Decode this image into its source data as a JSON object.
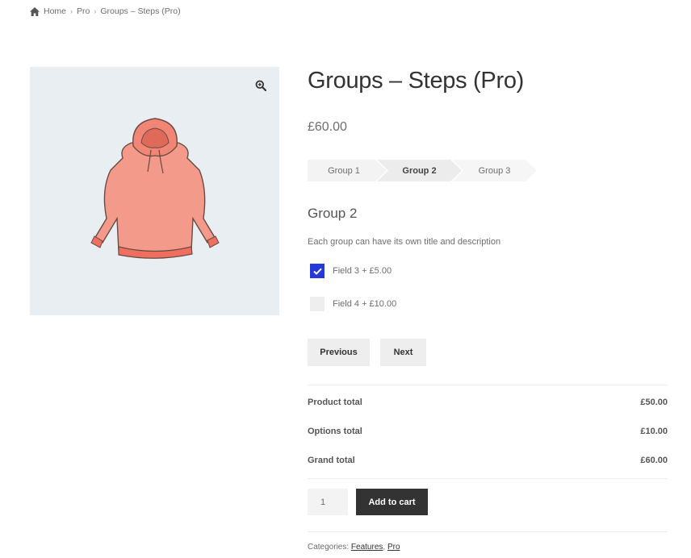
{
  "breadcrumb": {
    "home": "Home",
    "sep1": "›",
    "category": "Pro",
    "sep2": "›",
    "current": "Groups – Steps (Pro)"
  },
  "product": {
    "title": "Groups – Steps (Pro)",
    "price": "£60.00"
  },
  "steps": [
    {
      "label": "Group 1"
    },
    {
      "label": "Group 2"
    },
    {
      "label": "Group 3"
    }
  ],
  "group": {
    "title": "Group 2",
    "description": "Each group can have its own title and description"
  },
  "options": [
    {
      "label": "Field 3 + £5.00",
      "checked": true
    },
    {
      "label": "Field 4 + £10.00",
      "checked": false
    }
  ],
  "nav": {
    "previous": "Previous",
    "next": "Next"
  },
  "totals": {
    "product_label": "Product total",
    "product_value": "£50.00",
    "options_label": "Options total",
    "options_value": "£10.00",
    "grand_label": "Grand total",
    "grand_value": "£60.00"
  },
  "cart": {
    "quantity": "1",
    "add_label": "Add to cart"
  },
  "categories": {
    "label": "Categories:",
    "first": "Features",
    "comma": ",",
    "second": "Pro"
  },
  "colors": {
    "accent": "#2638d9",
    "dark_button": "#333333",
    "gallery_bg": "#e9eef2",
    "hoodie": "#f08c7c"
  },
  "icons": [
    "home-icon",
    "zoom-icon",
    "check-icon"
  ]
}
